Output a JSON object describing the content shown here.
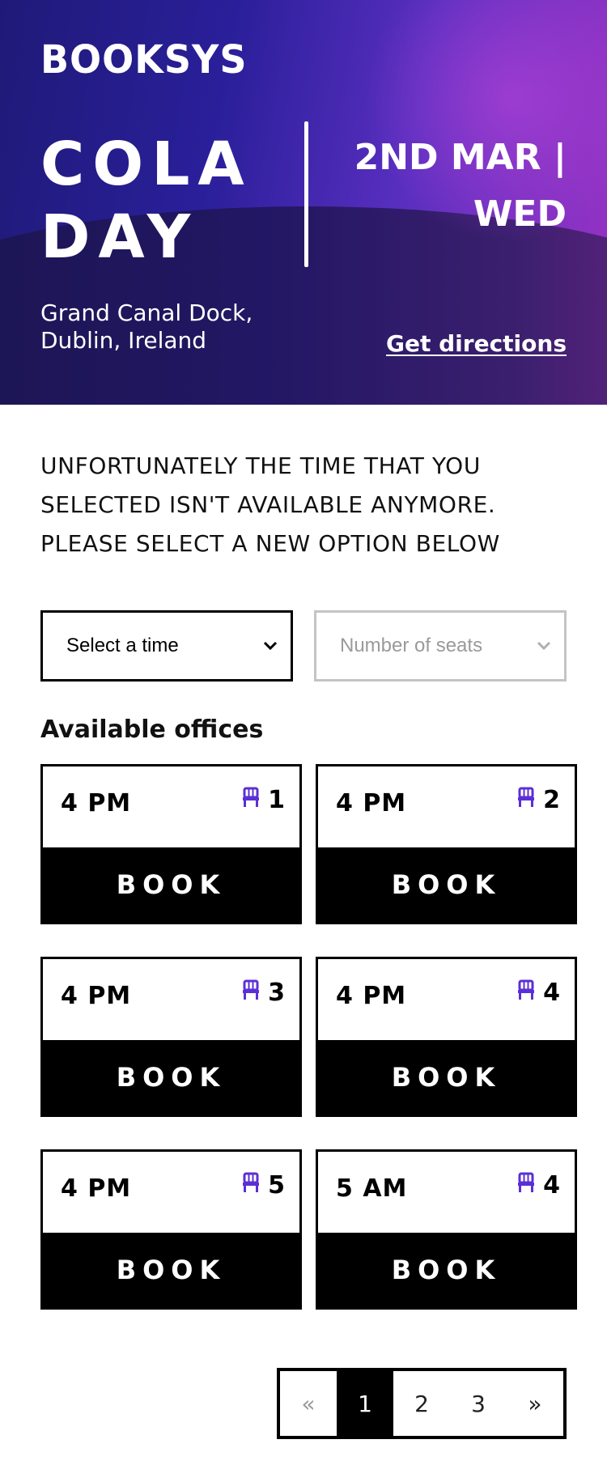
{
  "brand": {
    "logo": "BOOKSYS"
  },
  "event": {
    "title": "COLA DAY",
    "date": "2ND MAR | WED",
    "location": "Grand Canal Dock, Dublin, Ireland",
    "directions_label": "Get directions"
  },
  "message": "UNFORTUNATELY THE TIME THAT YOU SELECTED ISN'T AVAILABLE ANYMORE. PLEASE SELECT A NEW OPTION BELOW",
  "filters": {
    "time": {
      "value": "Select a time"
    },
    "seats": {
      "placeholder": "Number of seats"
    }
  },
  "offices": {
    "heading": "Available offices",
    "book_label": "BOOK",
    "items": [
      {
        "time": "4 PM",
        "seats": "1"
      },
      {
        "time": "4 PM",
        "seats": "2"
      },
      {
        "time": "4 PM",
        "seats": "3"
      },
      {
        "time": "4 PM",
        "seats": "4"
      },
      {
        "time": "4 PM",
        "seats": "5"
      },
      {
        "time": "5 AM",
        "seats": "4"
      }
    ]
  },
  "pagination": {
    "prev": "«",
    "pages": [
      "1",
      "2",
      "3"
    ],
    "next": "»",
    "current": "1"
  },
  "icons": {
    "seat": "chair-icon",
    "select": "chevron-down-icon"
  },
  "colors": {
    "accent": "#5b2fd6",
    "hero_start": "#1f1a78",
    "hero_end": "#9a33c4"
  }
}
